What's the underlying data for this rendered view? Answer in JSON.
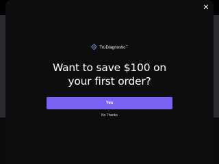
{
  "background": {
    "page_color": "#000000",
    "strip_color": "#2a2a2f"
  },
  "modal": {
    "close_icon": "close-icon",
    "logo": {
      "text": "TruDiagnostic",
      "trademark": "™",
      "icon": "trudiagnostic-logo-icon"
    },
    "headline": {
      "line1": "Want to save $100 on",
      "line2": "your first order?"
    },
    "yes_label": "Yes",
    "no_label": "No Thanks",
    "colors": {
      "background": "#0d0d10",
      "accent": "#7a61f2",
      "text": "#ffffff"
    }
  }
}
